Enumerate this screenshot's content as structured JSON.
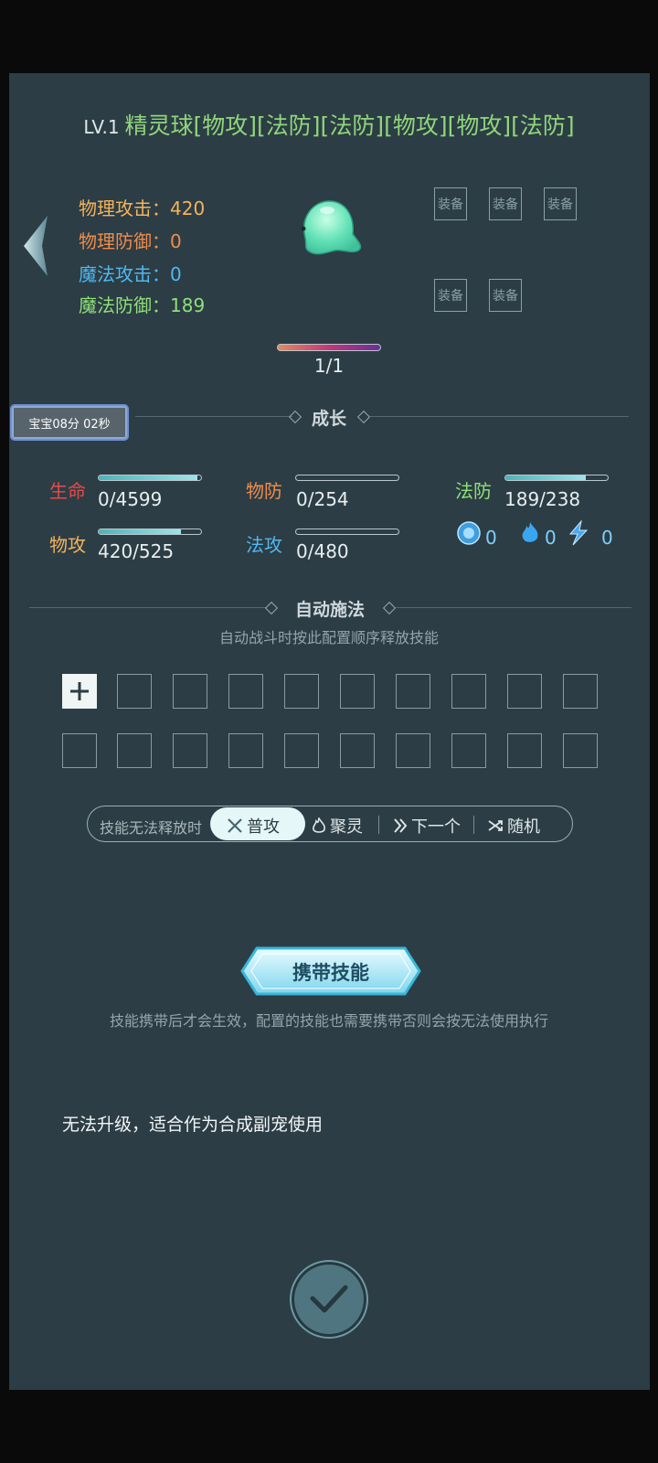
{
  "header": {
    "level": "LV.1",
    "name": "精灵球[物攻][法防][法防][物攻][物攻][法防]"
  },
  "stats": [
    {
      "label": "物理攻击：",
      "value": "420",
      "color": "#f4b35c"
    },
    {
      "label": "物理防御：",
      "value": "0",
      "color": "#f08d4b"
    },
    {
      "label": "魔法攻击：",
      "value": "0",
      "color": "#4fb8f0"
    },
    {
      "label": "魔法防御：",
      "value": "189",
      "color": "#8fe07a"
    }
  ],
  "equip": {
    "label": "装备"
  },
  "progress": {
    "text": "1/1",
    "fraction": 1.0
  },
  "timer": {
    "text": "宝宝08分 02秒"
  },
  "growth": {
    "title": "成长",
    "items": [
      {
        "label": "生命",
        "value": "0/4599",
        "fraction": 0.96,
        "color": "#e64a48"
      },
      {
        "label": "物防",
        "value": "0/254",
        "fraction": 0.0,
        "color": "#f08d4b"
      },
      {
        "label": "法防",
        "value": "189/238",
        "fraction": 0.79,
        "color": "#8fe07a"
      },
      {
        "label": "物攻",
        "value": "420/525",
        "fraction": 0.8,
        "color": "#f4b35c"
      },
      {
        "label": "法攻",
        "value": "0/480",
        "fraction": 0.0,
        "color": "#4fb8f0"
      }
    ],
    "elements": [
      {
        "icon": "water-orb-icon",
        "value": "0"
      },
      {
        "icon": "blue-flame-icon",
        "value": "0"
      },
      {
        "icon": "lightning-icon",
        "value": "0"
      }
    ]
  },
  "auto": {
    "title": "自动施法",
    "subtitle": "自动战斗时按此配置顺序释放技能"
  },
  "fallback": {
    "label": "技能无法释放时",
    "options": [
      {
        "label": "普攻",
        "icon": "crossed-swords-icon",
        "selected": true
      },
      {
        "label": "聚灵",
        "icon": "spirit-flame-icon",
        "selected": false
      },
      {
        "label": "下一个",
        "icon": "double-chevron-icon",
        "selected": false
      },
      {
        "label": "随机",
        "icon": "shuffle-icon",
        "selected": false
      }
    ]
  },
  "carry": {
    "button": "携带技能",
    "hint": "技能携带后才会生效，配置的技能也需要携带否则会按无法使用执行"
  },
  "note": "无法升级，适合作为合成副宠使用"
}
